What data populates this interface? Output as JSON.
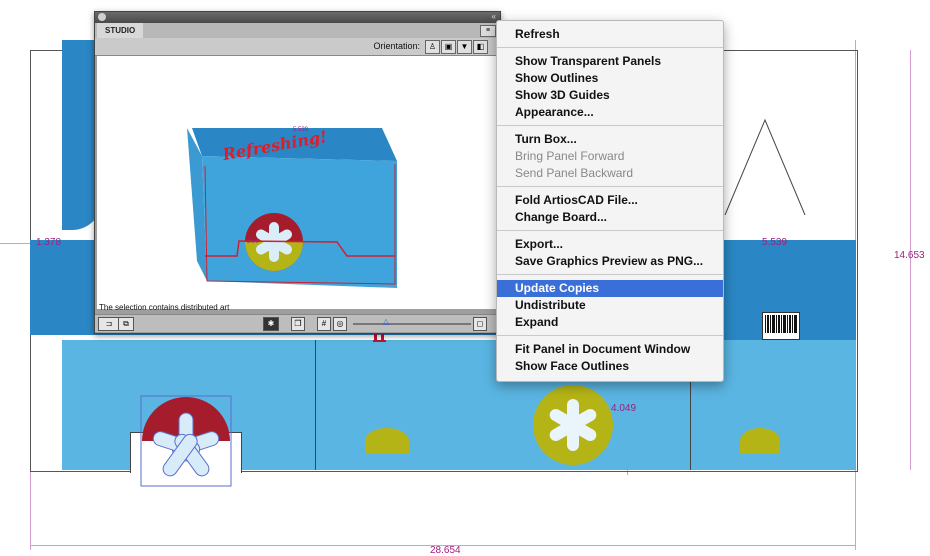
{
  "studio": {
    "tab_label": "STUDIO",
    "orientation_label": "Orientation:",
    "status_text": "The selection contains distributed art",
    "box_brand": "Refreshing!",
    "box_small": "5.539",
    "box_dim": "5.90"
  },
  "menu": {
    "items": [
      {
        "label": "Refresh"
      },
      {
        "label": "Show Transparent Panels"
      },
      {
        "label": "Show Outlines"
      },
      {
        "label": "Show 3D Guides"
      },
      {
        "label": "Appearance..."
      },
      {
        "label": "Turn Box..."
      },
      {
        "label": "Bring Panel Forward"
      },
      {
        "label": "Send Panel Backward"
      },
      {
        "label": "Fold ArtiosCAD File..."
      },
      {
        "label": "Change Board..."
      },
      {
        "label": "Export..."
      },
      {
        "label": "Save Graphics Preview as PNG..."
      },
      {
        "label": "Update Copies"
      },
      {
        "label": "Undistribute"
      },
      {
        "label": "Expand"
      },
      {
        "label": "Fit Panel in Document Window"
      },
      {
        "label": "Show Face Outlines"
      }
    ]
  },
  "dimensions": {
    "left_flap": "1.378",
    "right_panel": "5.539",
    "height": "14.653",
    "width": "28.654",
    "depth": "4.049"
  },
  "colors": {
    "sky_blue": "#5ab5e2",
    "deep_blue": "#2a86c4",
    "red": "#a51c2c",
    "olive": "#b5b417",
    "menu_highlight": "#3a6fd8",
    "dimension": "#a0207f"
  },
  "icons": [
    "orientation-front-icon",
    "orientation-back-icon",
    "orientation-top-icon",
    "orientation-side-icon",
    "panel-menu-icon"
  ]
}
